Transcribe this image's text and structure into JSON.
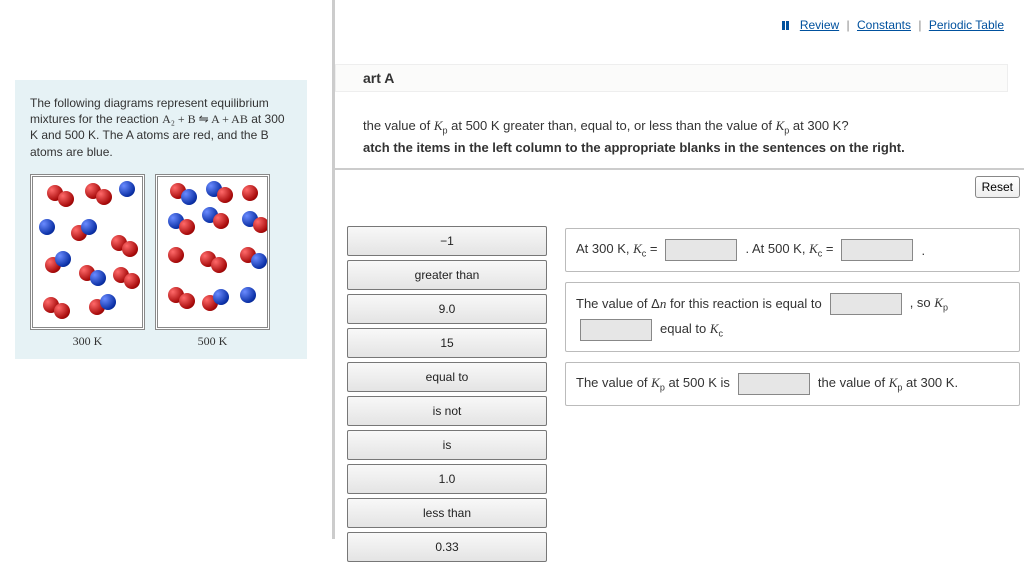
{
  "top_links": {
    "review": "Review",
    "constants": "Constants",
    "periodic": "Periodic Table"
  },
  "left_panel": {
    "paragraph_1": "The following diagrams represent equilibrium mixtures for the reaction ",
    "reaction": "A₂ + B ⇋ A + AB",
    "paragraph_2": " at 300 K and 500 K. The A atoms are red, and the B atoms are blue.",
    "label_300": "300 K",
    "label_500": "500 K"
  },
  "part": {
    "title": "art A",
    "question": "the value of Kₚ at 500 K greater than, equal to, or less than the value of Kₚ at 300 K?",
    "instruction": "atch the items in the left column to the appropriate blanks in the sentences on the right."
  },
  "buttons": {
    "reset": "Reset"
  },
  "tiles": [
    "−1",
    "greater than",
    "9.0",
    "15",
    "equal to",
    "is not",
    "is",
    "1.0",
    "less than",
    "0.33"
  ],
  "sentences": {
    "s1": {
      "a": "At 300 K, ",
      "kc": "K꜀ = ",
      "b": ". At 500 K, ",
      "kc2": "K꜀ = ",
      "c": "."
    },
    "s2": {
      "a": "The value of Δn for this reaction is equal to ",
      "b": ", so ",
      "kp": "Kₚ ",
      "c": "equal to ",
      "kc": "K꜀"
    },
    "s3": {
      "a": "The value of ",
      "kp": "Kₚ",
      "b": " at 500 K is ",
      "c": "the value of ",
      "kp2": "Kₚ",
      "d": " at 300 K."
    }
  }
}
